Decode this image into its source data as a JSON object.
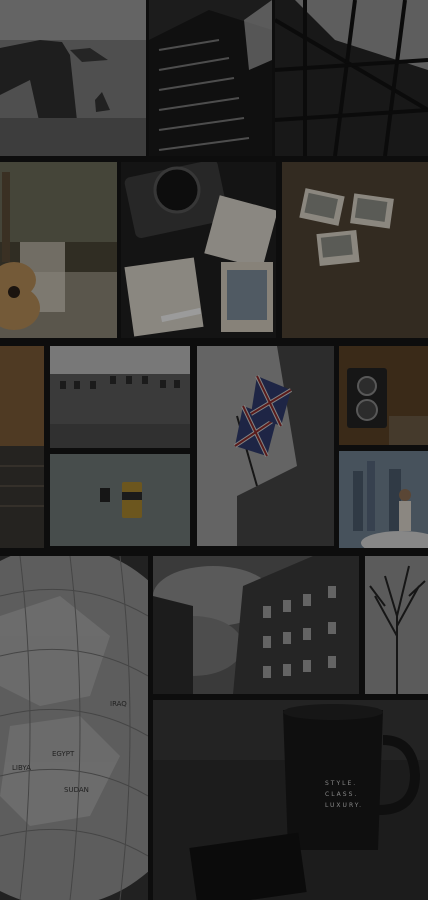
{
  "collage": {
    "tiles": [
      {
        "id": "sea-arch",
        "label": "sea arch rock photo"
      },
      {
        "id": "building-up",
        "label": "skyscraper looking up photo"
      },
      {
        "id": "glass-roof",
        "label": "glass roof photo"
      },
      {
        "id": "ukulele",
        "label": "ukulele photo"
      },
      {
        "id": "camera-photos",
        "label": "camera and photos photo"
      },
      {
        "id": "polaroids",
        "label": "polaroids on table photo"
      },
      {
        "id": "sunset-sea",
        "label": "sunset sea photo"
      },
      {
        "id": "old-street",
        "label": "old street photo"
      },
      {
        "id": "film-roll",
        "label": "film roll photo"
      },
      {
        "id": "flags",
        "label": "union flags photo"
      },
      {
        "id": "vintage-camera",
        "label": "vintage camera photo"
      },
      {
        "id": "city-people",
        "label": "city people photo"
      },
      {
        "id": "globe",
        "label": "globe map photo"
      },
      {
        "id": "building-sky",
        "label": "building and clouds photo"
      },
      {
        "id": "tree",
        "label": "bare tree photo"
      },
      {
        "id": "mug",
        "label": "black mug photo"
      }
    ],
    "mug_text": {
      "line1": "STYLE.",
      "line2": "CLASS.",
      "line3": "LUXURY."
    },
    "globe_labels": [
      "EGYPT",
      "LIBYA",
      "SUDAN",
      "IRAQ"
    ]
  }
}
